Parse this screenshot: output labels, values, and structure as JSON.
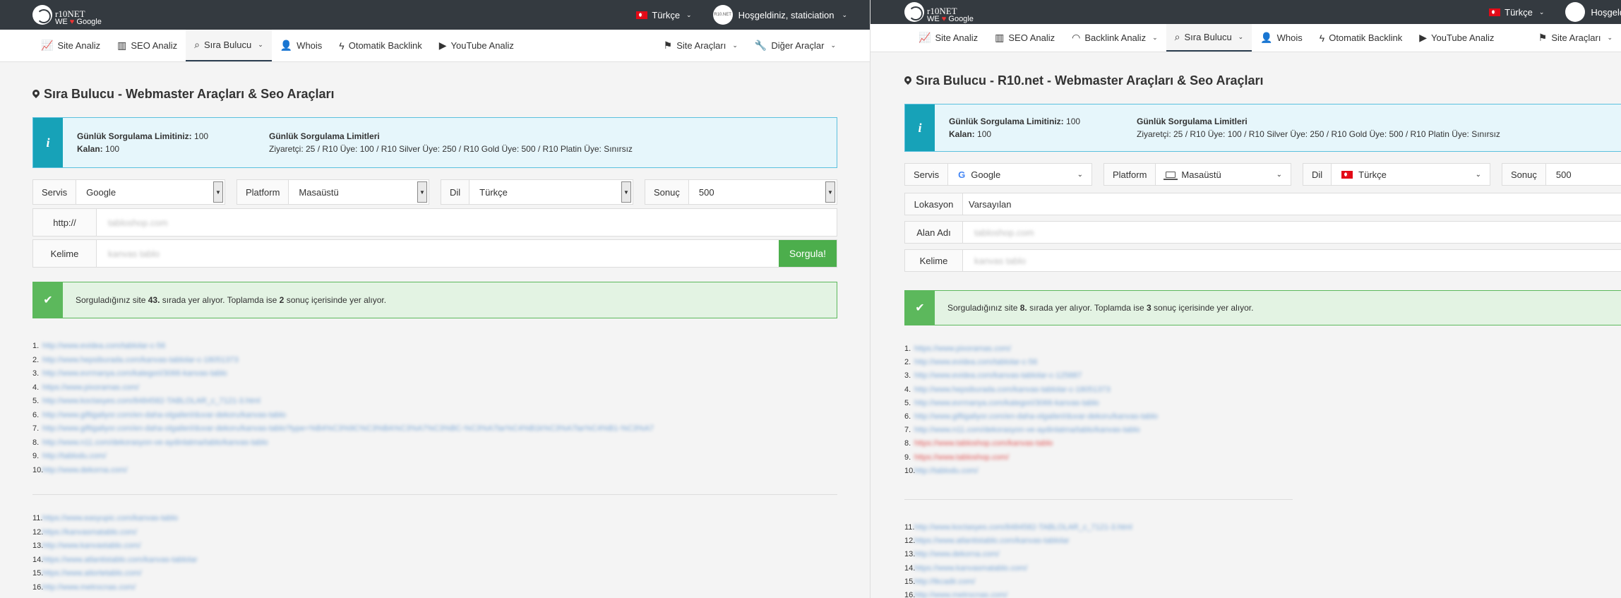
{
  "left": {
    "header": {
      "logo_main": "r10",
      "logo_net": "NET",
      "logo_we": "WE",
      "logo_google": "Google",
      "language": "Türkçe",
      "avatar_text": "R10.NET",
      "greeting": "Hoşgeldiniz, staticiation"
    },
    "nav": {
      "items": [
        {
          "label": "Site Analiz",
          "icon": "chart-line-icon"
        },
        {
          "label": "SEO Analiz",
          "icon": "bar-chart-icon"
        },
        {
          "label": "Sıra Bulucu",
          "icon": "search-icon"
        },
        {
          "label": "Whois",
          "icon": "user-secret-icon"
        },
        {
          "label": "Otomatik Backlink",
          "icon": "bolt-icon"
        },
        {
          "label": "YouTube Analiz",
          "icon": "youtube-icon"
        }
      ],
      "right": [
        {
          "label": "Site Araçları",
          "icon": "signpost-icon"
        },
        {
          "label": "Diğer Araçlar",
          "icon": "wrench-icon"
        }
      ]
    },
    "page_title": "Sıra Bulucu - Webmaster Araçları & Seo Araçları",
    "info": {
      "icon": "i",
      "limit_label": "Günlük Sorgulama Limitiniz:",
      "limit_value": "100",
      "remaining_label": "Kalan:",
      "remaining_value": "100",
      "limits_title": "Günlük Sorgulama Limitleri",
      "limits_text": "Ziyaretçi: 25 / R10 Üye: 100 / R10 Silver Üye: 250 / R10 Gold Üye: 500 / R10 Platin Üye: Sınırsız"
    },
    "filters": {
      "service_label": "Servis",
      "service_value": "Google",
      "platform_label": "Platform",
      "platform_value": "Masaüstü",
      "language_label": "Dil",
      "language_value": "Türkçe",
      "result_label": "Sonuç",
      "result_value": "500"
    },
    "domain_label": "http://",
    "domain_value": "tabloshop.com",
    "keyword_label": "Kelime",
    "keyword_value": "kanvas tablo",
    "submit": "Sorgula!",
    "result": {
      "pre": "Sorguladığınız site ",
      "rank": "43.",
      "mid": " sırada yer alıyor. Toplamda ise ",
      "total": "2",
      "post": " sonuç içerisinde yer alıyor."
    },
    "results_a": [
      {
        "num": "1.",
        "url": "http://www.evidea.com/tablolar-c-56"
      },
      {
        "num": "2.",
        "url": "http://www.hepsiburada.com/kanvas-tablolar-c-18051373"
      },
      {
        "num": "3.",
        "url": "http://www.evrmanya.com/kategori/3066-kanvas-tablo"
      },
      {
        "num": "4.",
        "url": "https://www.pixoramas.com/"
      },
      {
        "num": "5.",
        "url": "http://www.koctasyes.com/8484582-TABLOLAR_c_7121-3.html"
      },
      {
        "num": "6.",
        "url": "http://www.giftigaliyor.com/en-daha-olgaileri/duvar-dekoru/kanvas-tablo"
      },
      {
        "num": "7.",
        "url": "http://www.giftigaliyor.com/en-daha-olgaileri/duvar-dekoru/kanvas-tablo?type=%B4%C3%9C%C3%BA%C3%A7%C3%BC-%C3%A7lar%C4%B1k%C3%A7lar%C4%B1-%C3%A7"
      },
      {
        "num": "8.",
        "url": "http://www.n11.com/dekorasyon-ve-aydinlatma/tablo/kanvas-tablo"
      },
      {
        "num": "9.",
        "url": "http://tablodu.com/"
      },
      {
        "num": "10.",
        "url": "http://www.dekorna.com/"
      }
    ],
    "results_b": [
      {
        "num": "11.",
        "url": "https://www.easyupic.com/kanvas-tablo"
      },
      {
        "num": "12.",
        "url": "https://kanvasmatablo.com/"
      },
      {
        "num": "13.",
        "url": "http://www.kanvastablo.com/"
      },
      {
        "num": "14.",
        "url": "https://www.atlantistablo.com/kanvas-tablolar"
      },
      {
        "num": "15.",
        "url": "https://www.aitortetablo.com/"
      },
      {
        "num": "16.",
        "url": "http://www.metrocnas.com/"
      }
    ]
  },
  "right": {
    "header": {
      "logo_main": "r10",
      "logo_net": "NET",
      "logo_we": "WE",
      "logo_google": "Google",
      "language": "Türkçe",
      "greeting": "Hoşgeldi"
    },
    "nav": {
      "items": [
        {
          "label": "Site Analiz",
          "icon": "chart-line-icon"
        },
        {
          "label": "SEO Analiz",
          "icon": "bar-chart-icon"
        },
        {
          "label": "Backlink Analiz",
          "icon": "rss-icon"
        },
        {
          "label": "Sıra Bulucu",
          "icon": "search-icon"
        },
        {
          "label": "Whois",
          "icon": "user-secret-icon"
        },
        {
          "label": "Otomatik Backlink",
          "icon": "bolt-icon"
        },
        {
          "label": "YouTube Analiz",
          "icon": "youtube-icon"
        }
      ],
      "right": [
        {
          "label": "Site Araçları",
          "icon": "signpost-icon"
        }
      ]
    },
    "page_title": "Sıra Bulucu - R10.net - Webmaster Araçları & Seo Araçları",
    "info": {
      "icon": "i",
      "limit_label": "Günlük Sorgulama Limitiniz:",
      "limit_value": "100",
      "remaining_label": "Kalan:",
      "remaining_value": "100",
      "limits_title": "Günlük Sorgulama Limitleri",
      "limits_text": "Ziyaretçi: 25 / R10 Üye: 100 / R10 Silver Üye: 250 / R10 Gold Üye: 500 / R10 Platin Üye: Sınırsız"
    },
    "filters": {
      "service_label": "Servis",
      "service_value": "Google",
      "platform_label": "Platform",
      "platform_value": "Masaüstü",
      "language_label": "Dil",
      "language_value": "Türkçe",
      "result_label": "Sonuç",
      "result_value": "500"
    },
    "location_label": "Lokasyon",
    "location_value": "Varsayılan",
    "domain_label": "Alan Adı",
    "domain_value": "tabloshop.com",
    "keyword_label": "Kelime",
    "keyword_value": "kanvas tablo",
    "result": {
      "pre": "Sorguladığınız site ",
      "rank": "8.",
      "mid": " sırada yer alıyor. Toplamda ise ",
      "total": "3",
      "post": " sonuç içerisinde yer alıyor."
    },
    "results_a": [
      {
        "num": "1.",
        "url": "https://www.pixoramas.com/"
      },
      {
        "num": "2.",
        "url": "http://www.evidea.com/tablolar-c-56"
      },
      {
        "num": "3.",
        "url": "http://www.evidea.com/kanvas-tablolar-c-125887"
      },
      {
        "num": "4.",
        "url": "http://www.hepsiburada.com/kanvas-tablolar-c-18051373"
      },
      {
        "num": "5.",
        "url": "http://www.evrmanya.com/kategori/3066-kanvas-tablo"
      },
      {
        "num": "6.",
        "url": "http://www.giftigaliyor.com/en-daha-olgaileri/duvar-dekoru/kanvas-tablo"
      },
      {
        "num": "7.",
        "url": "http://www.n11.com/dekorasyon-ve-aydinlatma/tablo/kanvas-tablo"
      },
      {
        "num": "8.",
        "url": "https://www.tabloshop.com/kanvas-tablo",
        "hl": true
      },
      {
        "num": "9.",
        "url": "https://www.tabloshop.com/",
        "hl": true
      },
      {
        "num": "10.",
        "url": "http://tablodu.com/"
      }
    ],
    "results_b": [
      {
        "num": "11.",
        "url": "http://www.koctasyes.com/8484582-TABLOLAR_c_7121-3.html"
      },
      {
        "num": "12.",
        "url": "https://www.atlantistablo.com/kanvas-tablolar"
      },
      {
        "num": "13.",
        "url": "http://www.dekorna.com/"
      },
      {
        "num": "14.",
        "url": "https://www.kanvasmatablo.com/"
      },
      {
        "num": "15.",
        "url": "http://tkcadir.com/"
      },
      {
        "num": "16.",
        "url": "http://www.metrocnas.com/"
      }
    ]
  }
}
